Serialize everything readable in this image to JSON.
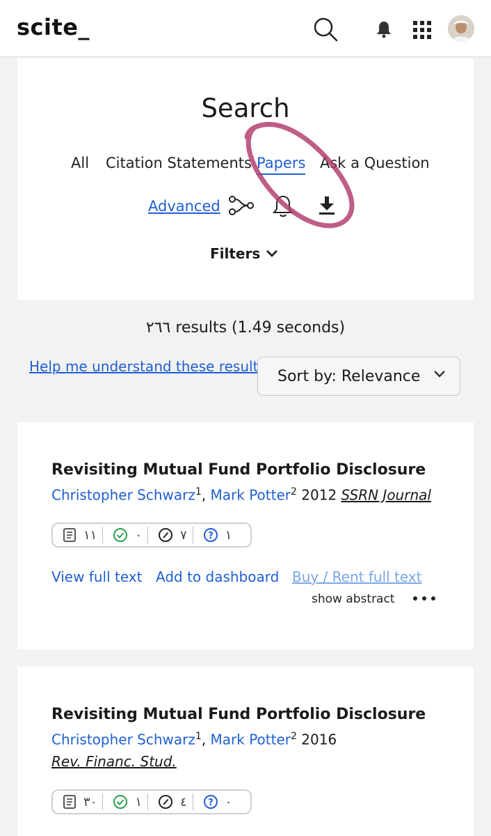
{
  "app": {
    "logo": "scite_",
    "icons": [
      "search-icon",
      "bell-icon",
      "apps-grid-icon",
      "avatar"
    ]
  },
  "search": {
    "title": "Search",
    "tabs": [
      {
        "label": "All",
        "active": false
      },
      {
        "label": "Citation Statements",
        "active": false
      },
      {
        "label": "Papers",
        "active": true
      },
      {
        "label": "Ask a Question",
        "active": false
      }
    ],
    "advanced_label": "Advanced",
    "filters_label": "Filters"
  },
  "results": {
    "count_text": "٢٦٦ results (1.49 seconds)",
    "help_link": "Help me understand these results",
    "sort_label": "Sort by: Relevance"
  },
  "papers": [
    {
      "title": "Revisiting Mutual Fund Portfolio Disclosure",
      "authors": [
        {
          "name": "Christopher Schwarz",
          "sup": "1"
        },
        {
          "name": "Mark Potter",
          "sup": "2"
        }
      ],
      "year": "2012",
      "journal": "SSRN Journal",
      "counts": {
        "mentioning": "١١",
        "supporting": "٠",
        "contrasting": "٧",
        "unclassified": "١"
      },
      "actions": {
        "view": "View full text",
        "dashboard": "Add to dashboard",
        "rent": "Buy / Rent full text",
        "abstract": "show abstract"
      }
    },
    {
      "title": "Revisiting Mutual Fund Portfolio Disclosure",
      "authors": [
        {
          "name": "Christopher Schwarz",
          "sup": "1"
        },
        {
          "name": "Mark Potter",
          "sup": "2"
        }
      ],
      "year": "2016",
      "journal": "Rev. Financ. Stud.",
      "counts": {
        "mentioning": "٣٠",
        "supporting": "١",
        "contrasting": "٤",
        "unclassified": "٠"
      }
    }
  ],
  "colors": {
    "accent": "#1f5fd1",
    "annotation": "#b03a6b",
    "supporting": "#2e9e4f",
    "background": "#f2f2f2"
  }
}
